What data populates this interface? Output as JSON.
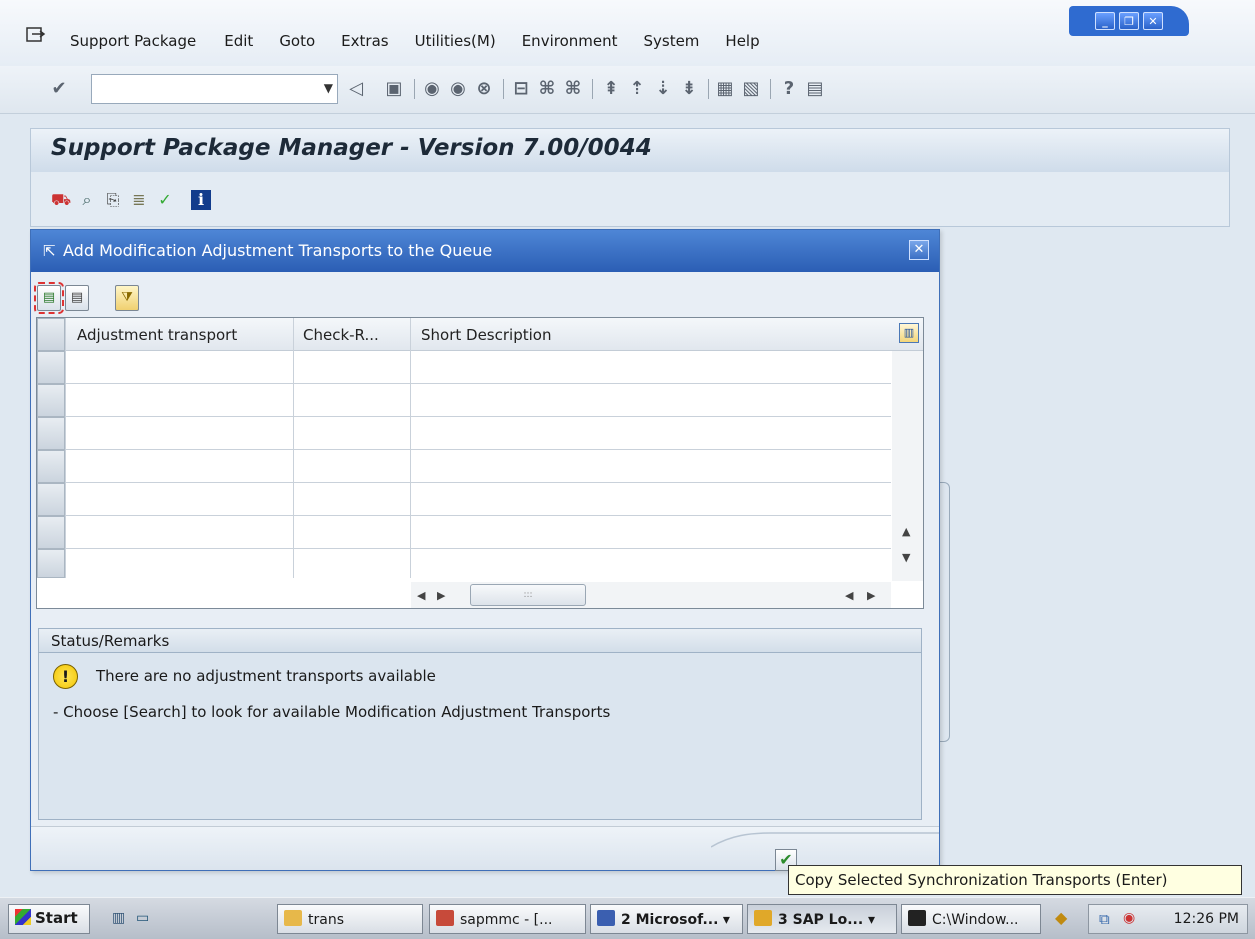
{
  "menubar": {
    "items": [
      "Support Package",
      "Edit",
      "Goto",
      "Extras",
      "Utilities(M)",
      "Environment",
      "System",
      "Help"
    ]
  },
  "title": "Support Package Manager - Version 7.00/0044",
  "dialog": {
    "title": "Add Modification Adjustment Transports to the Queue",
    "columns": [
      "Adjustment transport",
      "Check-R...",
      "Short Description"
    ],
    "status": {
      "header": "Status/Remarks",
      "message": "There are no adjustment transports available",
      "hint": "- Choose [Search] to look for available Modification Adjustment Transports"
    },
    "ok_symbol": "✔"
  },
  "tooltip": "Copy Selected Synchronization Transports   (Enter)",
  "taskbar": {
    "start": "Start",
    "buttons": [
      {
        "label": "trans",
        "icon_color": "#e7b84a"
      },
      {
        "label": "sapmmc - [...",
        "icon_color": "#c74a3a"
      },
      {
        "label": "2 Microsof...",
        "icon_color": "#3b5fb0"
      },
      {
        "label": "3 SAP Lo...",
        "icon_color": "#e0a829"
      },
      {
        "label": "C:\\Window...",
        "icon_color": "#222222"
      }
    ],
    "clock": "12:26 PM"
  }
}
